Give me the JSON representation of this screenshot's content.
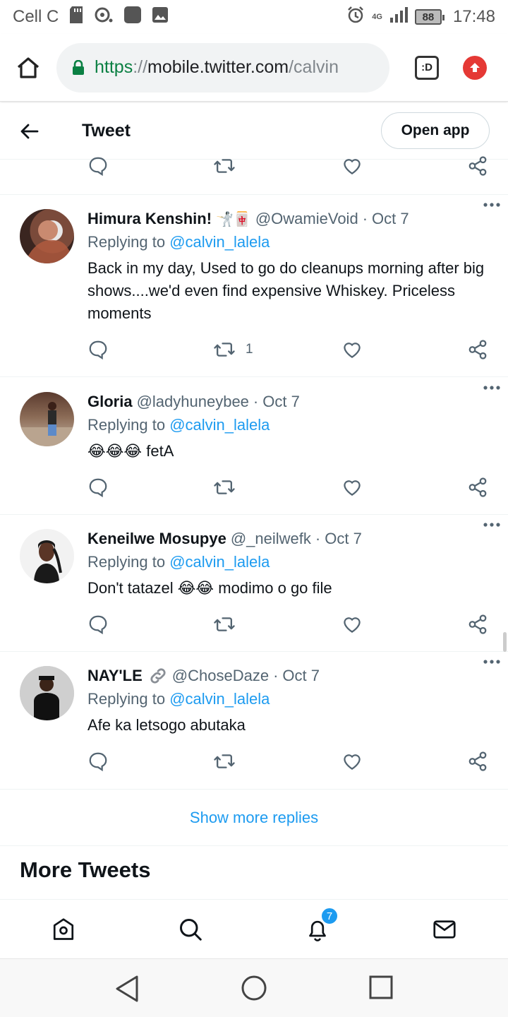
{
  "status_bar": {
    "carrier": "Cell C",
    "network": "4G",
    "battery": "88",
    "time": "17:48"
  },
  "browser": {
    "url_scheme": "https",
    "url_sep": "://",
    "url_host": "mobile.twitter.com",
    "url_path": "/calvin",
    "tabs_label": ":D"
  },
  "header": {
    "title": "Tweet",
    "open_app": "Open app"
  },
  "tweets": [
    {
      "name": "Himura Kenshin!",
      "name_emoji": "🤺🀄",
      "handle": "@OwamieVoid",
      "date": "Oct 7",
      "replying_prefix": "Replying to ",
      "replying_to": "@calvin_lalela",
      "text": "Back in my day, Used to go do cleanups morning after big shows....we'd even find expensive Whiskey. Priceless moments",
      "retweets": "1"
    },
    {
      "name": "Gloria",
      "handle": "@ladyhuneybee",
      "date": "Oct 7",
      "replying_prefix": "Replying to ",
      "replying_to": "@calvin_lalela",
      "text": "😂😂😂 fetA"
    },
    {
      "name": "Keneilwe Mosupye",
      "handle": "@_neilwefk",
      "date": "Oct 7",
      "replying_prefix": "Replying to ",
      "replying_to": "@calvin_lalela",
      "text": "Don't tatazel 😂😂 modimo o go file"
    },
    {
      "name": "NAY'LE",
      "handle": "@ChoseDaze",
      "date": "Oct 7",
      "replying_prefix": "Replying to ",
      "replying_to": "@calvin_lalela",
      "text": "Afe ka letsogo abutaka"
    }
  ],
  "show_more": "Show more replies",
  "more_tweets": "More Tweets",
  "bottom_nav": {
    "notifications_badge": "7"
  },
  "colors": {
    "twitter_blue": "#1d9bf0",
    "secure_green": "#0b8043",
    "muted": "#536471"
  }
}
